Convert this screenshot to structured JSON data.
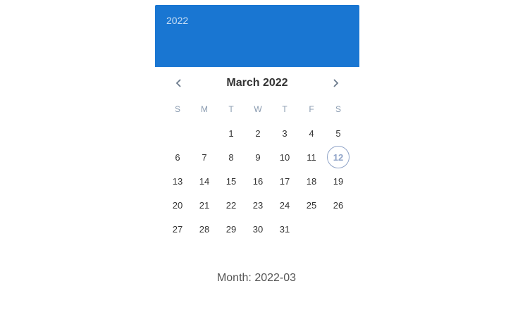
{
  "picker": {
    "header_year": "2022",
    "month_title": "March 2022",
    "prev_icon": "chevron-left-icon",
    "next_icon": "chevron-right-icon",
    "weekdays": [
      "S",
      "M",
      "T",
      "W",
      "T",
      "F",
      "S"
    ],
    "leading_blanks": 2,
    "days": [
      "1",
      "2",
      "3",
      "4",
      "5",
      "6",
      "7",
      "8",
      "9",
      "10",
      "11",
      "12",
      "13",
      "14",
      "15",
      "16",
      "17",
      "18",
      "19",
      "20",
      "21",
      "22",
      "23",
      "24",
      "25",
      "26",
      "27",
      "28",
      "29",
      "30",
      "31"
    ],
    "today": "12",
    "accent_color": "#1976d2"
  },
  "caption": "Month: 2022-03"
}
